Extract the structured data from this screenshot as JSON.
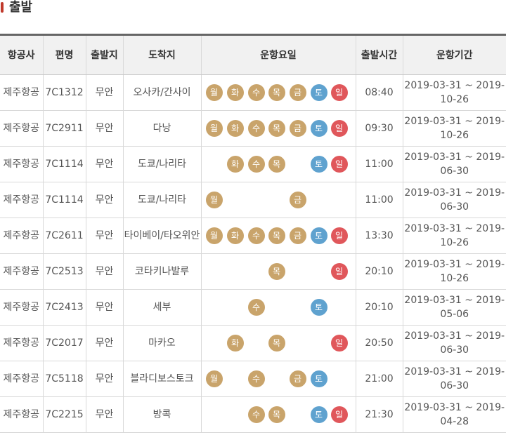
{
  "page": {
    "title": "출발"
  },
  "colors": {
    "weekday": "#c9a46b",
    "saturday": "#5fa2cf",
    "sunday": "#e0575b",
    "header_border": "#666666"
  },
  "table": {
    "headers": [
      "항공사",
      "편명",
      "출발지",
      "도착지",
      "운항요일",
      "출발시간",
      "운항기간"
    ],
    "rows": [
      {
        "airline": "제주항공",
        "flight": "7C1312",
        "from": "무안",
        "to": "오사카/간사이",
        "days": [
          "월",
          "화",
          "수",
          "목",
          "금",
          "토",
          "일"
        ],
        "time": "08:40",
        "period": "2019-03-31 ~ 2019-10-26"
      },
      {
        "airline": "제주항공",
        "flight": "7C2911",
        "from": "무안",
        "to": "다낭",
        "days": [
          "월",
          "화",
          "수",
          "목",
          "금",
          "토",
          "일"
        ],
        "time": "09:30",
        "period": "2019-03-31 ~ 2019-10-26"
      },
      {
        "airline": "제주항공",
        "flight": "7C1114",
        "from": "무안",
        "to": "도쿄/나리타",
        "days": [
          "",
          "화",
          "수",
          "목",
          "",
          "토",
          "일"
        ],
        "time": "11:00",
        "period": "2019-03-31 ~ 2019-06-30"
      },
      {
        "airline": "제주항공",
        "flight": "7C1114",
        "from": "무안",
        "to": "도쿄/나리타",
        "days": [
          "월",
          "",
          "",
          "",
          "금",
          "",
          ""
        ],
        "time": "11:00",
        "period": "2019-03-31 ~ 2019-06-30"
      },
      {
        "airline": "제주항공",
        "flight": "7C2611",
        "from": "무안",
        "to": "타이베이/타오위안",
        "days": [
          "월",
          "화",
          "수",
          "목",
          "금",
          "토",
          "일"
        ],
        "time": "13:30",
        "period": "2019-03-31 ~ 2019-10-26"
      },
      {
        "airline": "제주항공",
        "flight": "7C2513",
        "from": "무안",
        "to": "코타키나발루",
        "days": [
          "",
          "",
          "",
          "목",
          "",
          "",
          "일"
        ],
        "time": "20:10",
        "period": "2019-03-31 ~ 2019-10-26"
      },
      {
        "airline": "제주항공",
        "flight": "7C2413",
        "from": "무안",
        "to": "세부",
        "days": [
          "",
          "",
          "수",
          "",
          "",
          "토",
          ""
        ],
        "time": "20:10",
        "period": "2019-03-31 ~ 2019-05-06"
      },
      {
        "airline": "제주항공",
        "flight": "7C2017",
        "from": "무안",
        "to": "마카오",
        "days": [
          "",
          "화",
          "",
          "목",
          "",
          "",
          "일"
        ],
        "time": "20:50",
        "period": "2019-03-31 ~ 2019-06-30"
      },
      {
        "airline": "제주항공",
        "flight": "7C5118",
        "from": "무안",
        "to": "블라디보스토크",
        "days": [
          "월",
          "",
          "수",
          "",
          "금",
          "토",
          ""
        ],
        "time": "21:00",
        "period": "2019-03-31 ~ 2019-06-30"
      },
      {
        "airline": "제주항공",
        "flight": "7C2215",
        "from": "무안",
        "to": "방콕",
        "days": [
          "",
          "",
          "수",
          "목",
          "",
          "토",
          "일"
        ],
        "time": "21:30",
        "period": "2019-03-31 ~ 2019-04-28"
      }
    ]
  }
}
